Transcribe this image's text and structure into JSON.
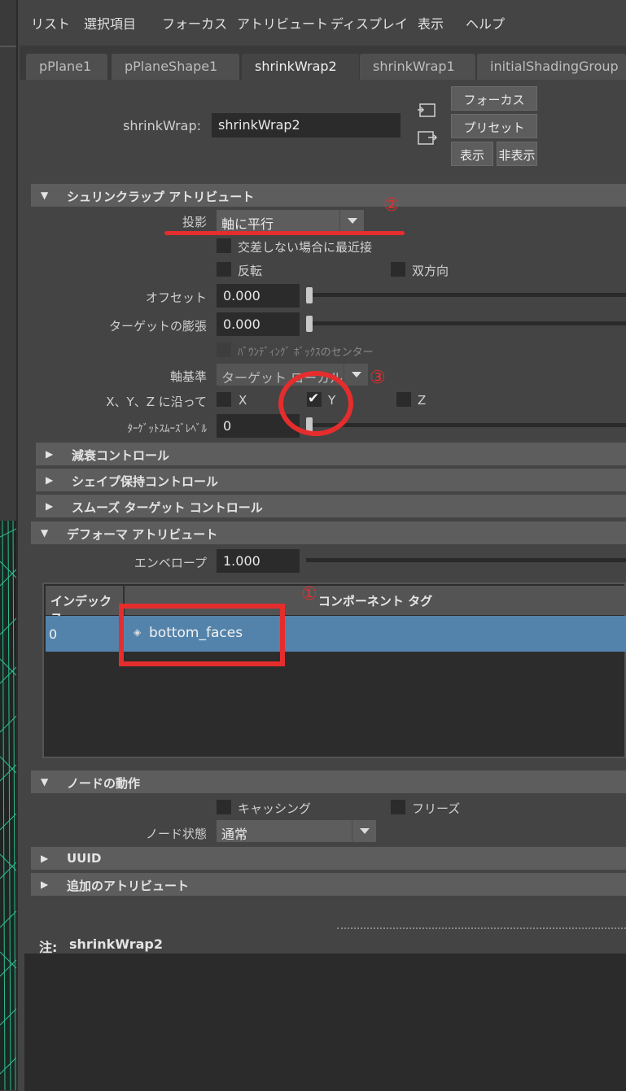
{
  "menu": [
    "リスト",
    "選択項目",
    "フォーカス",
    "アトリビュート",
    "ディスプレイ",
    "表示",
    "ヘルプ"
  ],
  "tabs": [
    "pPlane1",
    "pPlaneShape1",
    "shrinkWrap2",
    "shrinkWrap1",
    "initialShadingGroup"
  ],
  "header": {
    "node_label": "shrinkWrap:",
    "node_value": "shrinkWrap2",
    "buttons": {
      "focus": "フォーカス",
      "preset": "プリセット",
      "show": "表示",
      "hide": "非表示"
    }
  },
  "shrink_section": {
    "title": "シュリンクラップ アトリビュート",
    "projection_label": "投影",
    "projection_value": "軸に平行",
    "closest_label": "交差しない場合に最近接",
    "reverse_label": "反転",
    "bidirectional_label": "双方向",
    "offset_label": "オフセット",
    "offset_value": "0.000",
    "inflate_label": "ターゲットの膨張",
    "inflate_value": "0.000",
    "bbox_center_label": "ﾊﾞｳﾝﾃﾞｨﾝｸﾞ ﾎﾞｯｸｽのセンター",
    "axis_ref_label": "軸基準",
    "axis_ref_value": "ターゲット ローカル",
    "along_label": "X、Y、Z に沿って",
    "x_label": "X",
    "y_label": "Y",
    "z_label": "Z",
    "smooth_label": "ﾀｰｹﾞｯﾄｽﾑｰｽﾞﾚﾍﾞﾙ",
    "smooth_value": "0"
  },
  "collapsed": {
    "falloff": "減衰コントロール",
    "shape_preserve": "シェイプ保持コントロール",
    "smooth_target": "スムーズ ターゲット コントロール"
  },
  "deformer_section": {
    "title": "デフォーマ アトリビュート",
    "envelope_label": "エンベロープ",
    "envelope_value": "1.000",
    "table": {
      "headers": [
        "インデックス",
        "コンポーネント タグ"
      ],
      "rows": [
        {
          "index": "0",
          "tag": "bottom_faces"
        }
      ]
    }
  },
  "node_section": {
    "title": "ノードの動作",
    "caching_label": "キャッシング",
    "freeze_label": "フリーズ",
    "state_label": "ノード状態",
    "state_value": "通常"
  },
  "uuid_section": {
    "title": "UUID"
  },
  "extra_section": {
    "title": "追加のアトリビュート"
  },
  "notes": {
    "label": "注:",
    "value": "shrinkWrap2"
  },
  "annotations": {
    "one": "①",
    "two": "②",
    "three": "③"
  },
  "colors": {
    "annotation_red": "#e52d2d",
    "selected_row": "#5383ab"
  }
}
